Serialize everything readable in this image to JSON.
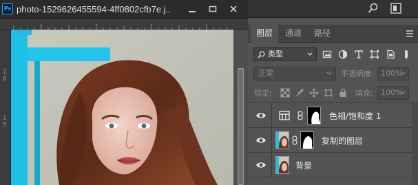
{
  "document": {
    "app_icon": "Ps",
    "title": "photo-1529626455594-4ff0802cfb7e.j...",
    "ruler_marks": [
      "1",
      "0",
      "1",
      "5"
    ]
  },
  "topbar": {
    "icons": [
      "search-icon",
      "workspace-icon"
    ]
  },
  "panel": {
    "tabs": [
      {
        "label": "图层",
        "active": true
      },
      {
        "label": "通道",
        "active": false
      },
      {
        "label": "路径",
        "active": false
      }
    ],
    "filter_kind": "类型",
    "blend_mode": "正常",
    "opacity_label": "不透明度:",
    "opacity_value": "100%",
    "lock_label": "锁定:",
    "fill_label": "填充:",
    "fill_value": "100%"
  },
  "layers": [
    {
      "name": "色相/饱和度 1",
      "type": "adjustment",
      "visible": true
    },
    {
      "name": "复制的图层",
      "type": "pixel-with-mask",
      "visible": true
    },
    {
      "name": "背景",
      "type": "background",
      "visible": true
    }
  ],
  "colors": {
    "accent": "#31a8ff",
    "panel_bg": "#535353",
    "title_bg": "#2b2b2b"
  }
}
